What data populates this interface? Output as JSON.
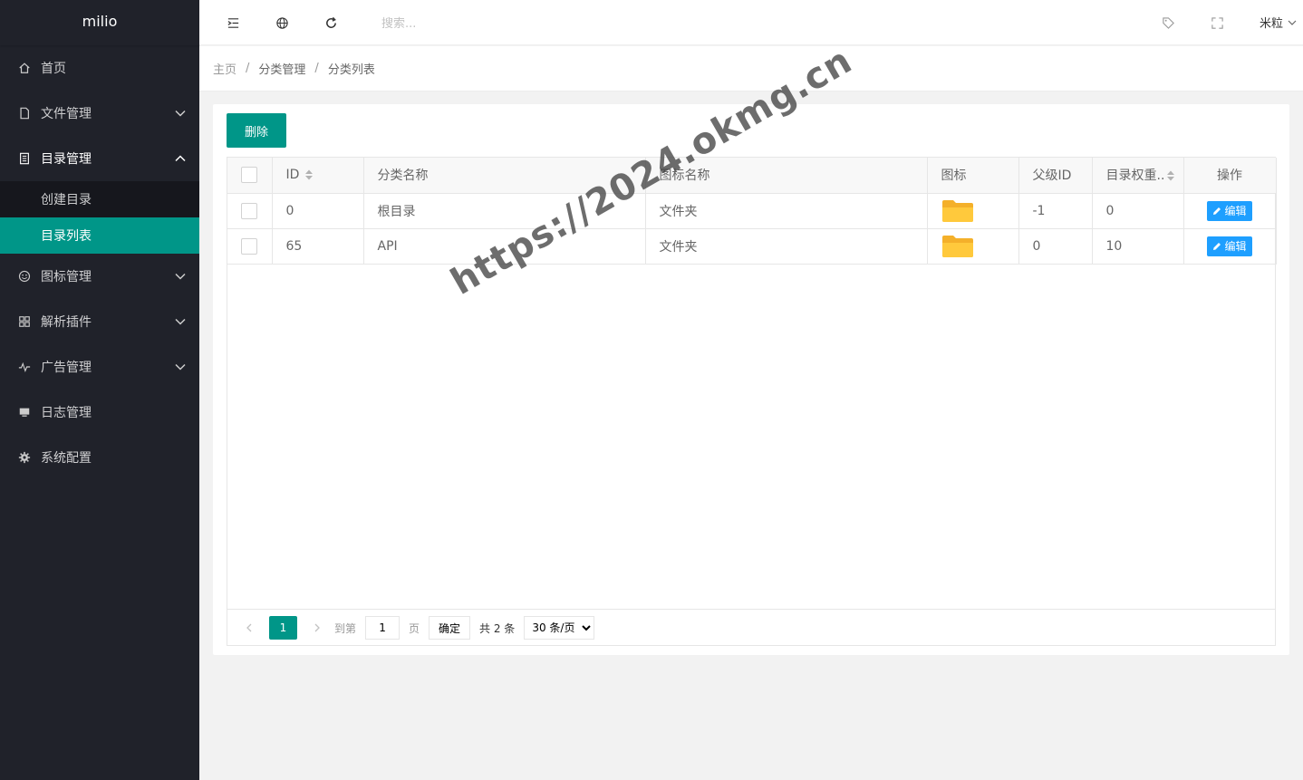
{
  "app": {
    "logo": "milio"
  },
  "sidebar": {
    "items": [
      {
        "label": "首页",
        "icon": "home-icon",
        "expandable": false
      },
      {
        "label": "文件管理",
        "icon": "file-icon",
        "expandable": true,
        "expanded": false
      },
      {
        "label": "目录管理",
        "icon": "list-doc-icon",
        "expandable": true,
        "expanded": true,
        "children": [
          {
            "label": "创建目录",
            "active": false
          },
          {
            "label": "目录列表",
            "active": true
          }
        ]
      },
      {
        "label": "图标管理",
        "icon": "smile-icon",
        "expandable": true,
        "expanded": false
      },
      {
        "label": "解析插件",
        "icon": "apps-icon",
        "expandable": true,
        "expanded": false
      },
      {
        "label": "广告管理",
        "icon": "pulse-icon",
        "expandable": true,
        "expanded": false
      },
      {
        "label": "日志管理",
        "icon": "monitor-icon",
        "expandable": false
      },
      {
        "label": "系统配置",
        "icon": "gear-icon",
        "expandable": false
      }
    ]
  },
  "header": {
    "search_placeholder": "搜索...",
    "user": "米粒",
    "icons": [
      "menu-shrink-icon",
      "globe-icon",
      "refresh-icon",
      "tag-icon",
      "fullscreen-icon"
    ]
  },
  "breadcrumb": [
    "主页",
    "分类管理",
    "分类列表"
  ],
  "toolbar": {
    "delete_label": "删除"
  },
  "table": {
    "columns": [
      "ID",
      "分类名称",
      "图标名称",
      "图标",
      "父级ID",
      "目录权重..",
      "操作"
    ],
    "rows": [
      {
        "id": "0",
        "name": "根目录",
        "icon_name": "文件夹",
        "parent_id": "-1",
        "weight": "0",
        "action": "编辑"
      },
      {
        "id": "65",
        "name": "API",
        "icon_name": "文件夹",
        "parent_id": "0",
        "weight": "10",
        "action": "编辑"
      }
    ]
  },
  "pager": {
    "current": "1",
    "goto_label": "到第",
    "goto_value": "1",
    "page_label": "页",
    "confirm_label": "确定",
    "total_label": "共 2 条",
    "page_size": "30 条/页"
  },
  "watermark": "https://2024.okmg.cn",
  "colors": {
    "sidebar_bg": "#20222a",
    "accent": "#009688",
    "edit_button": "#1e9fff",
    "folder": "#ffc93c"
  }
}
